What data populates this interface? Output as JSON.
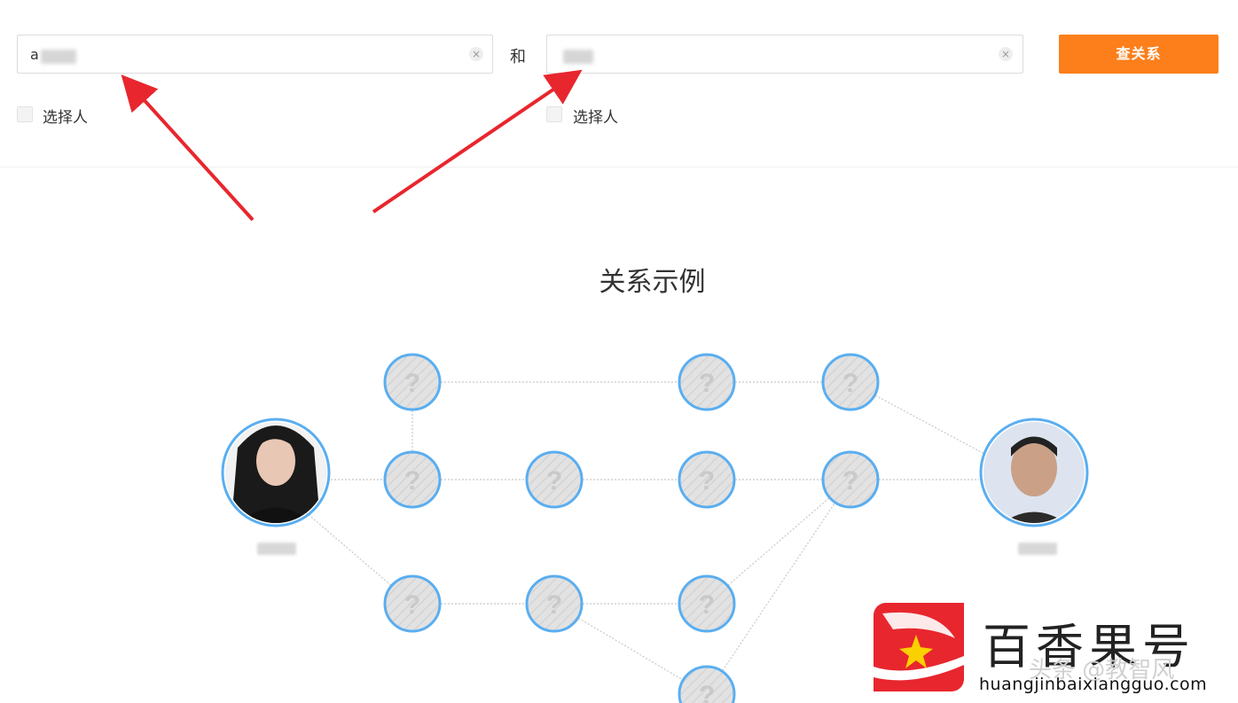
{
  "search": {
    "person_a": {
      "value": "a",
      "clear": "×",
      "select_label": "选择人"
    },
    "connector": "和",
    "person_b": {
      "value": "",
      "clear": "×",
      "select_label": "选择人"
    },
    "submit_label": "查关系"
  },
  "example": {
    "title": "关系示例",
    "unknown_glyph": "?"
  },
  "colors": {
    "accent": "#fc7f1b",
    "node_ring": "#5aaef0",
    "node_fill": "#dedede",
    "edge": "#c8c8c8",
    "arrow": "#e8262e",
    "logo": "#e8262e"
  },
  "watermark": {
    "brand": "百香果号",
    "overlay": "头条 @教智风",
    "domain": "huangjinbaixiangguo.com",
    "icon": "rocket-star-icon"
  }
}
